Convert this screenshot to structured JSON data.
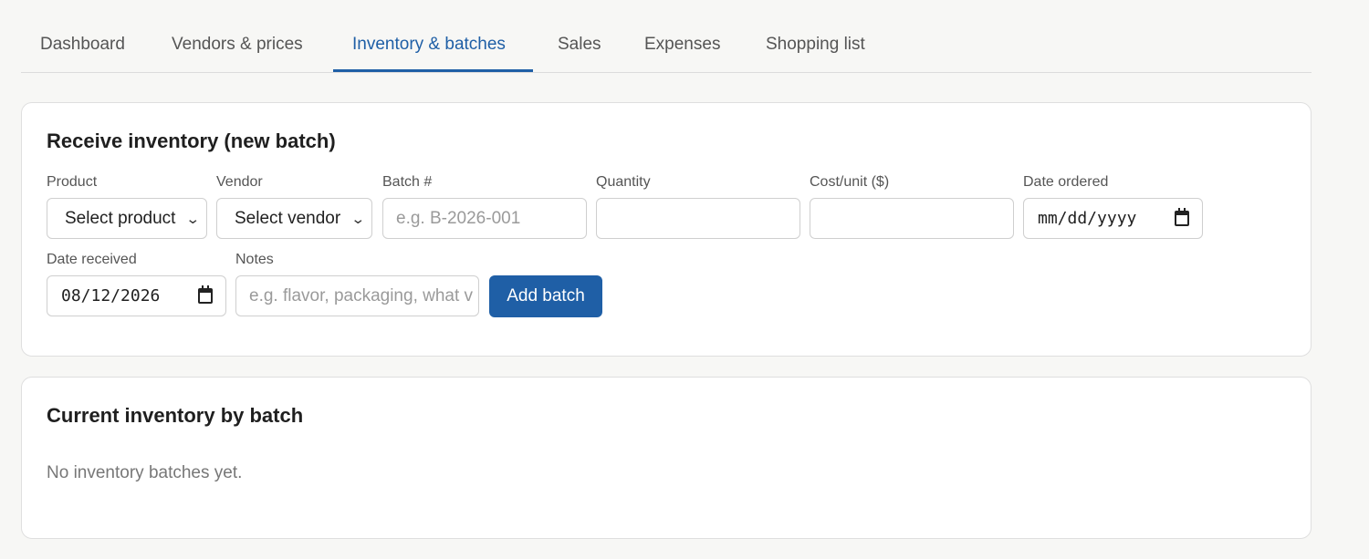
{
  "tabs": [
    {
      "label": "Dashboard",
      "active": false
    },
    {
      "label": "Vendors & prices",
      "active": false
    },
    {
      "label": "Inventory & batches",
      "active": true
    },
    {
      "label": "Sales",
      "active": false
    },
    {
      "label": "Expenses",
      "active": false
    },
    {
      "label": "Shopping list",
      "active": false
    }
  ],
  "receive_card": {
    "title": "Receive inventory (new batch)",
    "product": {
      "label": "Product",
      "value": "Select product"
    },
    "vendor": {
      "label": "Vendor",
      "value": "Select vendor"
    },
    "batch": {
      "label": "Batch #",
      "value": "",
      "placeholder": "e.g. B-2026-001"
    },
    "quantity": {
      "label": "Quantity",
      "value": ""
    },
    "cost_unit": {
      "label": "Cost/unit ($)",
      "value": ""
    },
    "date_ordered": {
      "label": "Date ordered",
      "value": "mm/dd/yyyy"
    },
    "date_received": {
      "label": "Date received",
      "value": "08/12/2026"
    },
    "notes": {
      "label": "Notes",
      "value": "",
      "placeholder": "e.g. flavor, packaging, what v"
    },
    "add_button": "Add batch"
  },
  "inventory_card": {
    "title": "Current inventory by batch",
    "empty_message": "No inventory batches yet."
  },
  "colors": {
    "accent": "#1f5fa6",
    "background": "#f7f7f5",
    "card": "#ffffff",
    "border": "#dfdfdf"
  },
  "icons": {
    "select_chevron": "chevron-down-icon",
    "date_picker": "calendar-icon"
  }
}
